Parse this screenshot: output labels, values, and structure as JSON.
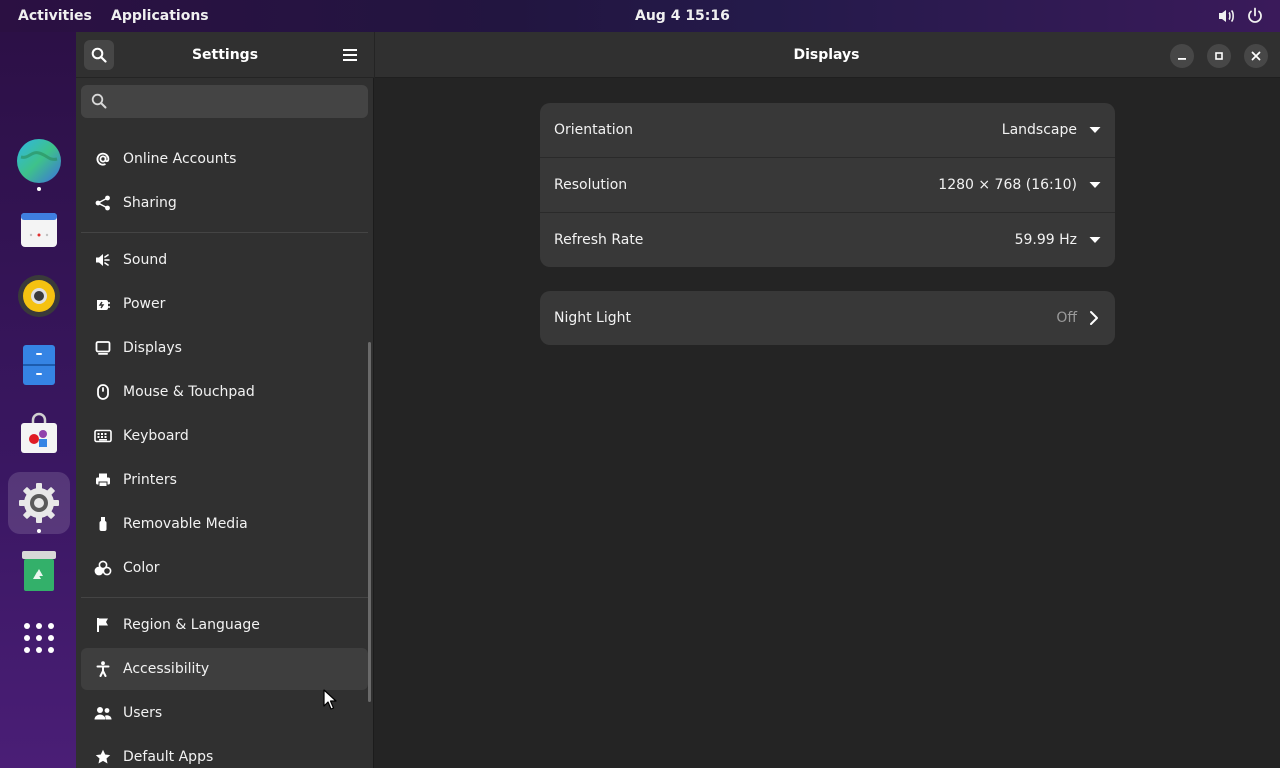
{
  "topbar": {
    "activities": "Activities",
    "applications": "Applications",
    "clock": "Aug 4  15:16",
    "volume_icon": "speaker-icon",
    "power_icon": "power-icon"
  },
  "dock": {
    "apps": [
      {
        "name": "web-browser",
        "icon": "globe-icon",
        "running": true
      },
      {
        "name": "calendar",
        "icon": "calendar-icon"
      },
      {
        "name": "music-player",
        "icon": "speaker-disc-icon"
      },
      {
        "name": "files",
        "icon": "file-cabinet-icon"
      },
      {
        "name": "software",
        "icon": "shopping-bag-icon"
      },
      {
        "name": "settings",
        "icon": "gear-icon",
        "active": true,
        "running": true
      },
      {
        "name": "trash",
        "icon": "recycle-bin-icon"
      },
      {
        "name": "show-applications",
        "icon": "app-grid-icon"
      }
    ]
  },
  "sidebar": {
    "title": "Settings",
    "search_placeholder": "",
    "items": [
      {
        "label": "Online Accounts",
        "icon": "at-sign-icon"
      },
      {
        "label": "Sharing",
        "icon": "share-icon"
      },
      {
        "label": "Sound",
        "icon": "speaker-icon"
      },
      {
        "label": "Power",
        "icon": "power-plug-icon"
      },
      {
        "label": "Displays",
        "icon": "monitor-icon"
      },
      {
        "label": "Mouse & Touchpad",
        "icon": "mouse-icon"
      },
      {
        "label": "Keyboard",
        "icon": "keyboard-icon"
      },
      {
        "label": "Printers",
        "icon": "printer-icon"
      },
      {
        "label": "Removable Media",
        "icon": "usb-drive-icon"
      },
      {
        "label": "Color",
        "icon": "color-circles-icon"
      },
      {
        "label": "Region & Language",
        "icon": "flag-icon"
      },
      {
        "label": "Accessibility",
        "icon": "accessibility-person-icon"
      },
      {
        "label": "Users",
        "icon": "users-icon"
      },
      {
        "label": "Default Apps",
        "icon": "star-icon"
      }
    ]
  },
  "content": {
    "title": "Displays",
    "display_settings": [
      {
        "label": "Orientation",
        "value": "Landscape"
      },
      {
        "label": "Resolution",
        "value": "1280 × 768 (16:10)"
      },
      {
        "label": "Refresh Rate",
        "value": "59.99 Hz"
      }
    ],
    "night_light": {
      "label": "Night Light",
      "value": "Off"
    }
  },
  "colors": {
    "window_bg": "#242424",
    "sidebar_bg": "#303030",
    "card_bg": "#383838",
    "accent_purple": "#3a1866"
  }
}
